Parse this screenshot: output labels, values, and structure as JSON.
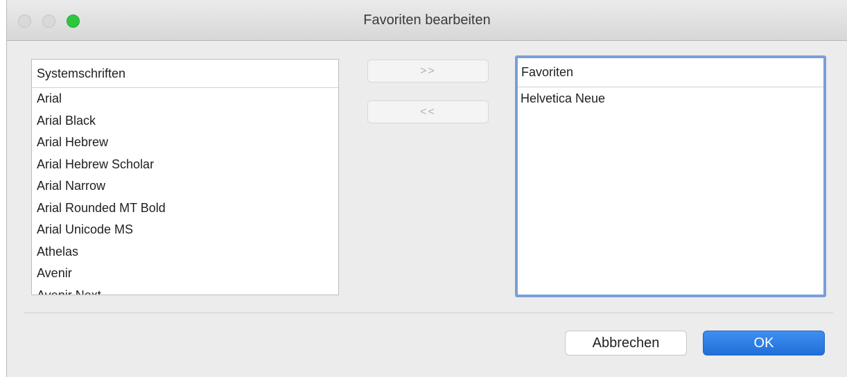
{
  "window": {
    "title": "Favoriten bearbeiten"
  },
  "system_fonts": {
    "header": "Systemschriften",
    "items": [
      "Arial",
      "Arial Black",
      "Arial Hebrew",
      "Arial Hebrew Scholar",
      "Arial Narrow",
      "Arial Rounded MT Bold",
      "Arial Unicode MS",
      "Athelas",
      "Avenir",
      "Avenir Next"
    ]
  },
  "move_buttons": {
    "add_label": ">>",
    "remove_label": "<<"
  },
  "favorites": {
    "header": "Favoriten",
    "items": [
      "Helvetica Neue"
    ]
  },
  "footer": {
    "cancel_label": "Abbrechen",
    "ok_label": "OK"
  },
  "colors": {
    "accent": "#1f6fd8",
    "focus_ring": "#7a9fd6",
    "zoom_button": "#2dc640"
  }
}
